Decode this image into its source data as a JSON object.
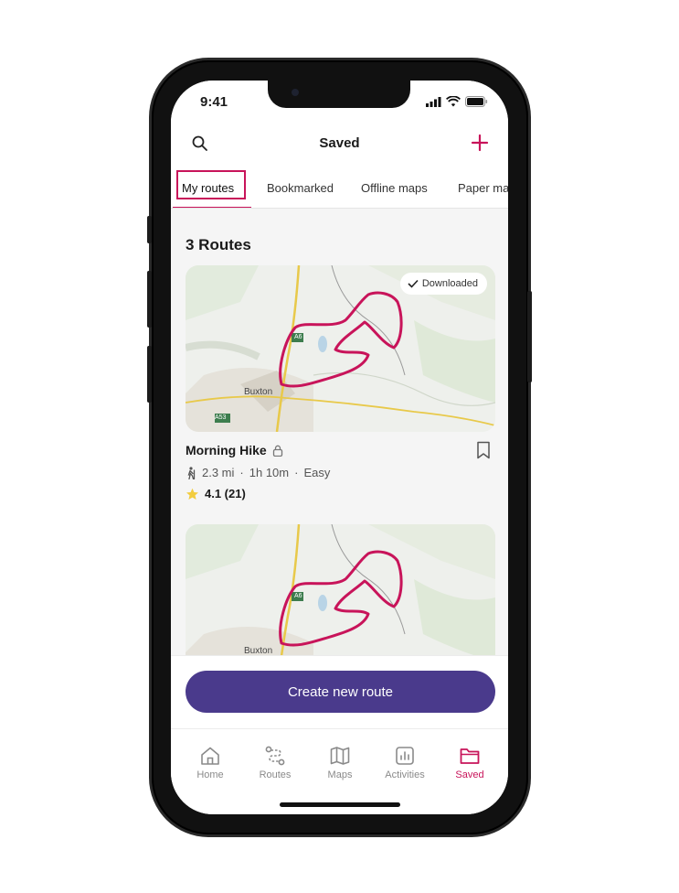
{
  "status_bar": {
    "time": "9:41"
  },
  "header": {
    "title": "Saved"
  },
  "tabs": [
    {
      "label": "My routes",
      "active": true
    },
    {
      "label": "Bookmarked",
      "active": false
    },
    {
      "label": "Offline maps",
      "active": false
    },
    {
      "label": "Paper maps",
      "active": false
    }
  ],
  "routes_count": "3 Routes",
  "map": {
    "town_label": "Buxton",
    "road_a6": "A6",
    "road_a53": "A53"
  },
  "routes": [
    {
      "badge": "Downloaded",
      "title": "Morning Hike",
      "distance": "2.3 mi",
      "duration": "1h 10m",
      "difficulty": "Easy",
      "rating": "4.1 (21)"
    }
  ],
  "cta": {
    "label": "Create new route"
  },
  "nav": {
    "items": [
      {
        "label": "Home",
        "icon": "home-icon"
      },
      {
        "label": "Routes",
        "icon": "routes-icon"
      },
      {
        "label": "Maps",
        "icon": "map-icon"
      },
      {
        "label": "Activities",
        "icon": "activities-icon"
      },
      {
        "label": "Saved",
        "icon": "folder-icon",
        "active": true
      }
    ]
  },
  "colors": {
    "accent": "#c8145a",
    "primary_button": "#4a3a8c",
    "route_line": "#c8145a"
  }
}
